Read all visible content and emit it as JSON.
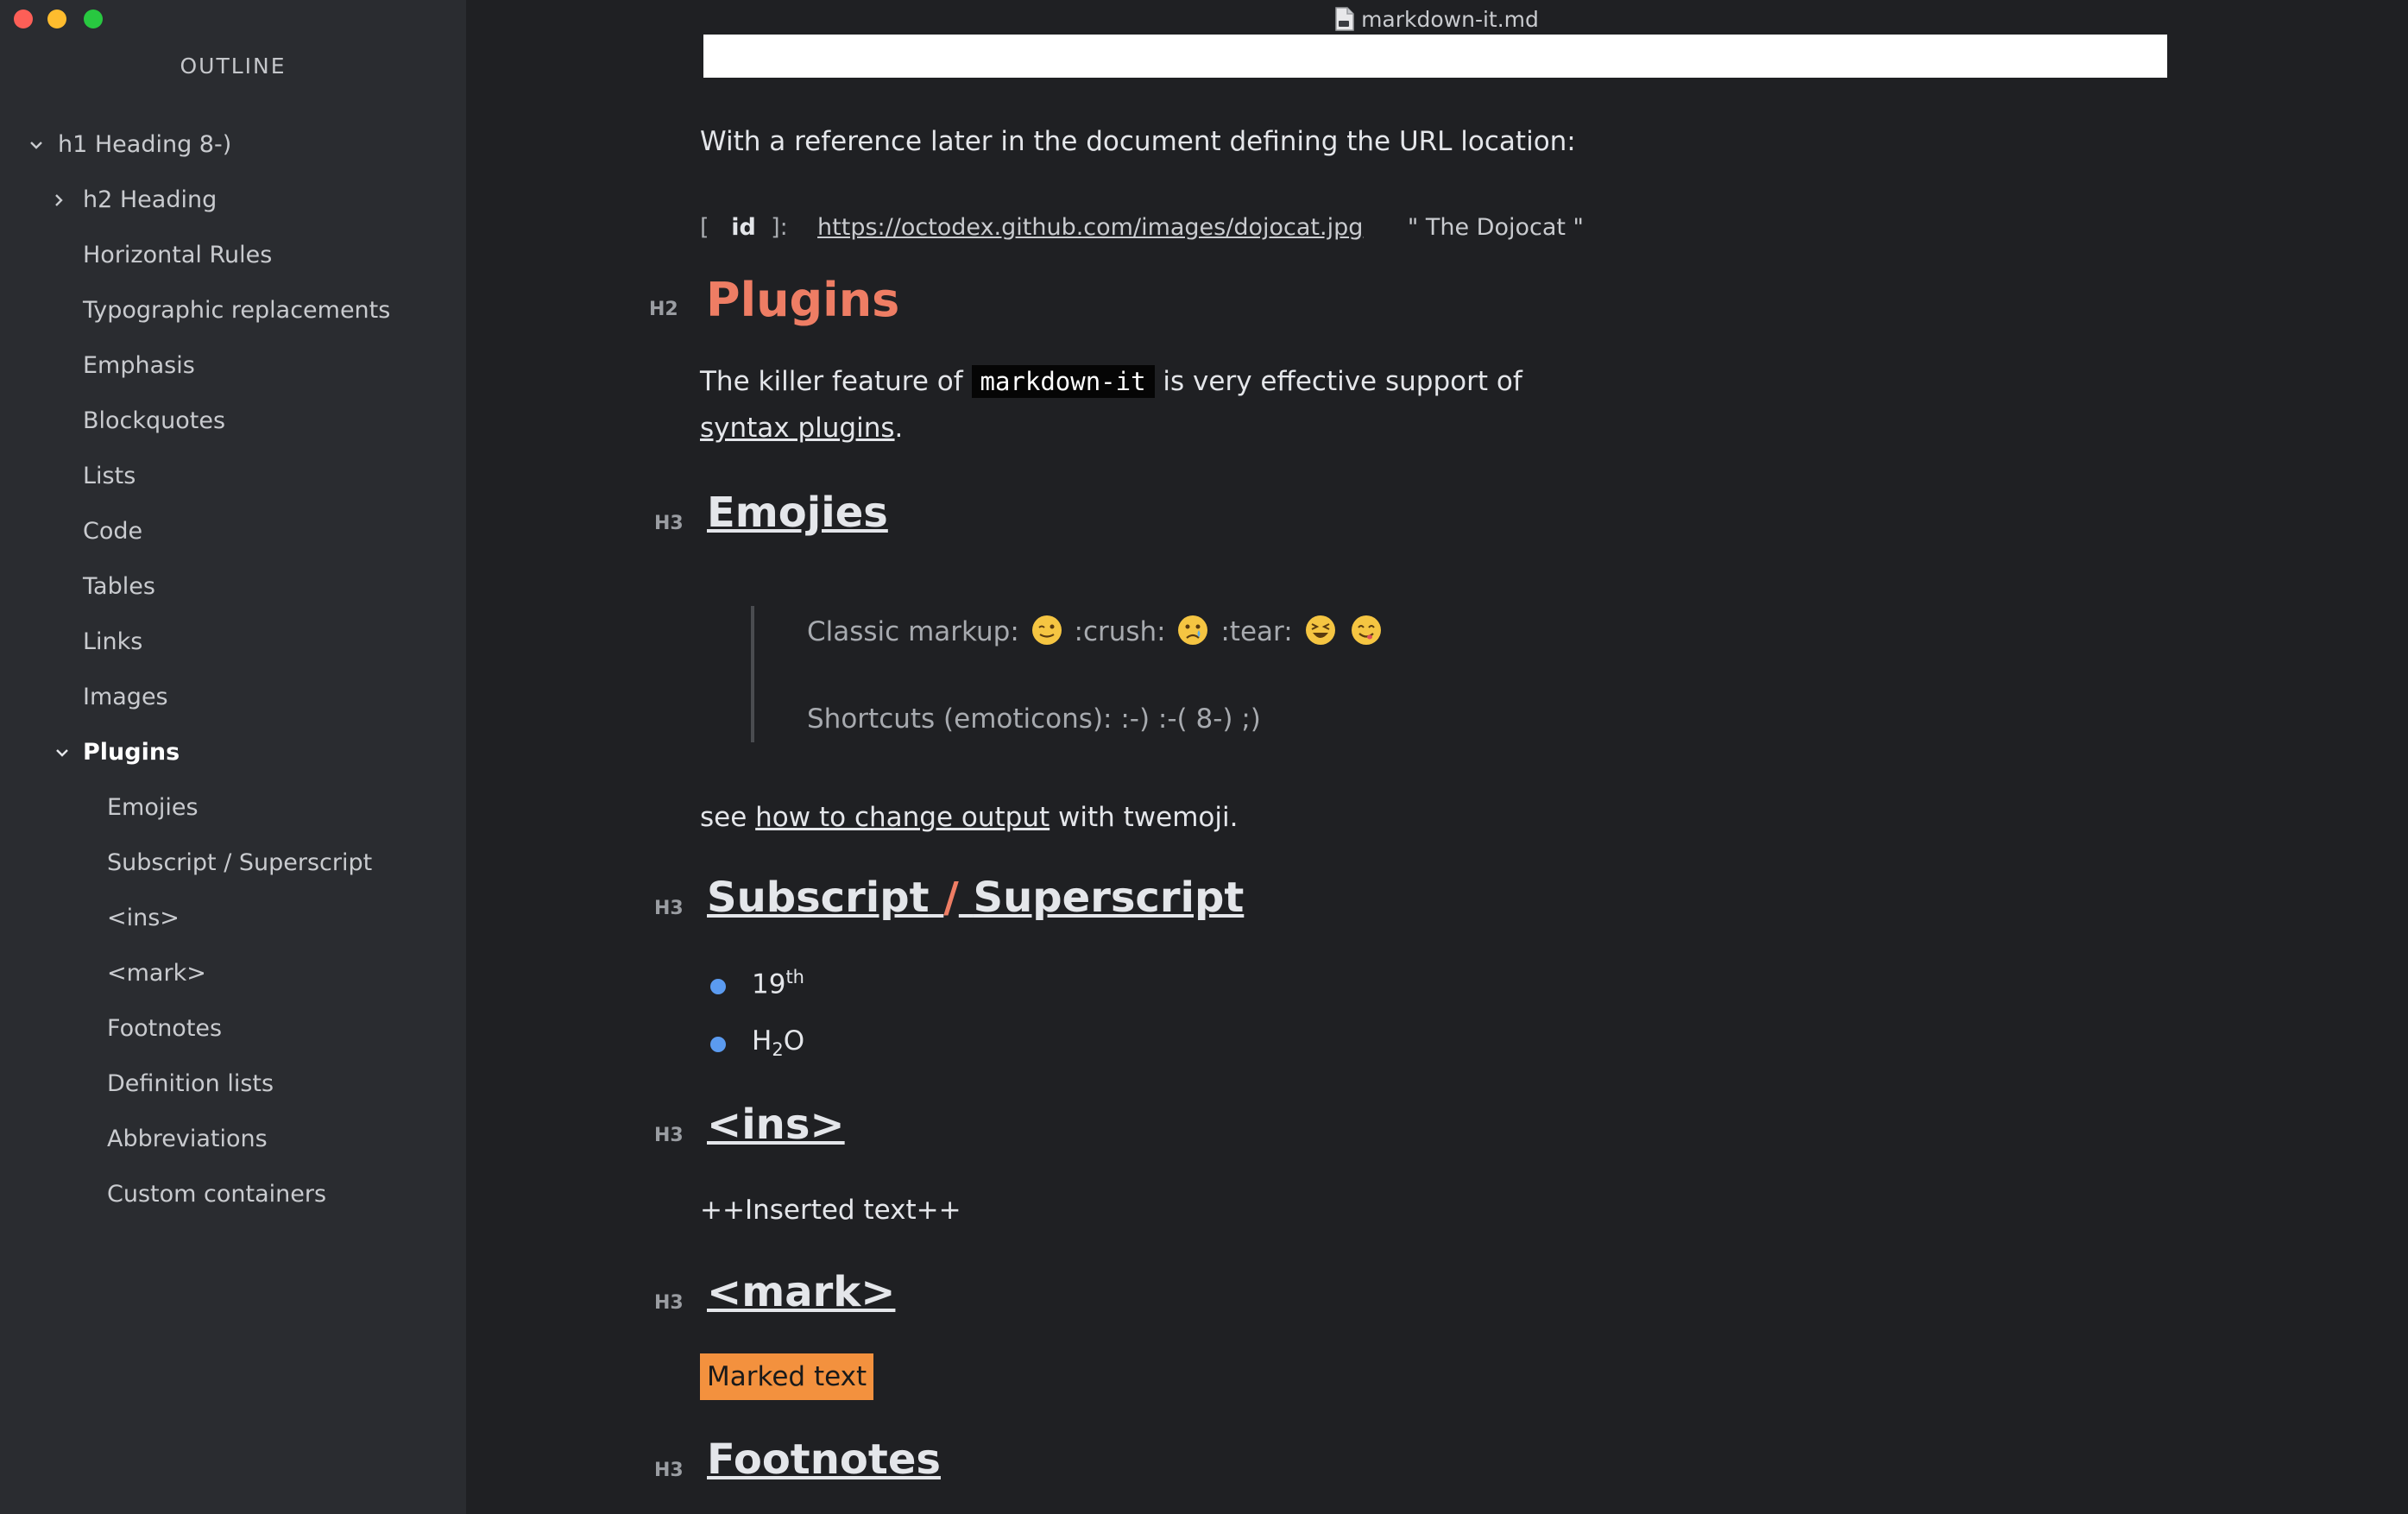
{
  "window": {
    "title": "markdown-it.md",
    "controls": [
      "close",
      "minimize",
      "maximize"
    ],
    "colors": {
      "close": "#fd5f57",
      "minimize": "#febc2e",
      "maximize": "#28c840"
    }
  },
  "sidebar": {
    "title": "OUTLINE",
    "items": [
      {
        "label": "h1 Heading 8-)",
        "level": 1,
        "expanded": true
      },
      {
        "label": "h2 Heading",
        "level": 2,
        "collapsed": true
      },
      {
        "label": "Horizontal Rules",
        "level": 2
      },
      {
        "label": "Typographic replacements",
        "level": 2
      },
      {
        "label": "Emphasis",
        "level": 2
      },
      {
        "label": "Blockquotes",
        "level": 2
      },
      {
        "label": "Lists",
        "level": 2
      },
      {
        "label": "Code",
        "level": 2
      },
      {
        "label": "Tables",
        "level": 2
      },
      {
        "label": "Links",
        "level": 2
      },
      {
        "label": "Images",
        "level": 2
      },
      {
        "label": "Plugins",
        "level": 2,
        "expanded": true,
        "active": true
      },
      {
        "label": "Emojies",
        "level": 3
      },
      {
        "label": "Subscript / Superscript",
        "level": 3
      },
      {
        "label": "<ins>",
        "level": 3
      },
      {
        "label": "<mark>",
        "level": 3
      },
      {
        "label": "Footnotes",
        "level": 3
      },
      {
        "label": "Definition lists",
        "level": 3
      },
      {
        "label": "Abbreviations",
        "level": 3
      },
      {
        "label": "Custom containers",
        "level": 3
      }
    ]
  },
  "content": {
    "ref_intro": "With a reference later in the document defining the URL location:",
    "ref_def": {
      "open": "[",
      "id": "id",
      "close": "]:",
      "url": "https://octodex.github.com/images/dojocat.jpg",
      "title": "\"  The Dojocat  \""
    },
    "plugins": {
      "label": "H2",
      "heading": "Plugins",
      "text_before": "The killer feature of",
      "code": "markdown-it",
      "text_after": "is very effective support of",
      "link": "syntax plugins",
      "link_after": "."
    },
    "emojies": {
      "label": "H3",
      "heading": "Emojies",
      "quote_line1_prefix": "Classic markup:",
      "crush": ":crush:",
      "tear": ":tear:",
      "quote_line2": "Shortcuts (emoticons): :-) :-( 8-) ;)",
      "see_prefix": "see",
      "see_link": "how to change output",
      "see_suffix": "with twemoji."
    },
    "subsup": {
      "label": "H3",
      "heading_left": "Subscript",
      "slash": "/",
      "heading_right": "Superscript",
      "item1_base": "19",
      "item1_sup": "th",
      "item2_base": "H",
      "item2_sub": "2",
      "item2_end": "O"
    },
    "ins": {
      "label": "H3",
      "heading": "<ins>",
      "text": "++Inserted text++"
    },
    "mark": {
      "label": "H3",
      "heading": "<mark>",
      "text": "Marked text"
    },
    "footnotes": {
      "label": "H3",
      "heading": "Footnotes"
    }
  },
  "colors": {
    "background": "#1f2023",
    "sidebar": "#2a2c30",
    "h2_accent": "#ee7d64",
    "mark_highlight": "#f3913e",
    "bullet": "#5b9bf0"
  }
}
